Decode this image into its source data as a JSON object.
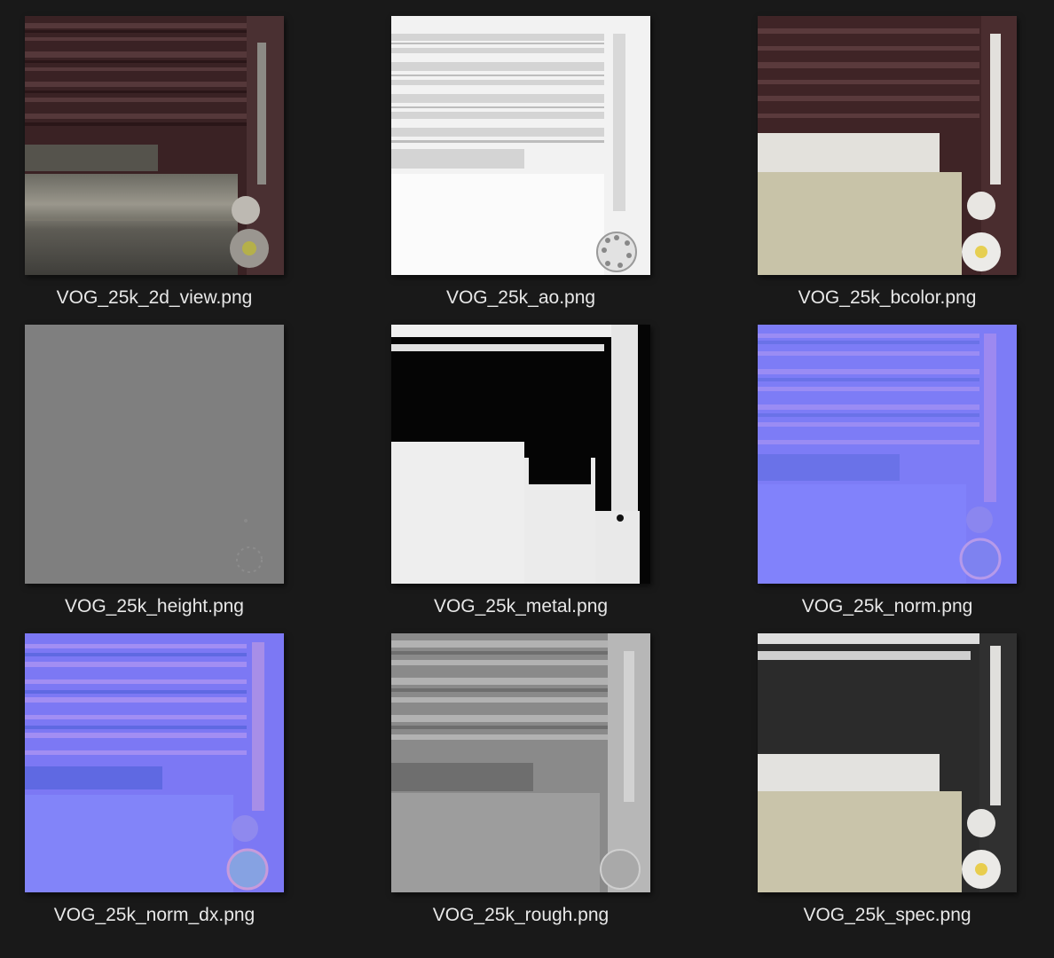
{
  "files": [
    {
      "name": "VOG_25k_2d_view.png",
      "icon": "texture-2d-view-thumbnail"
    },
    {
      "name": "VOG_25k_ao.png",
      "icon": "texture-ao-thumbnail"
    },
    {
      "name": "VOG_25k_bcolor.png",
      "icon": "texture-bcolor-thumbnail"
    },
    {
      "name": "VOG_25k_height.png",
      "icon": "texture-height-thumbnail"
    },
    {
      "name": "VOG_25k_metal.png",
      "icon": "texture-metal-thumbnail"
    },
    {
      "name": "VOG_25k_norm.png",
      "icon": "texture-norm-thumbnail"
    },
    {
      "name": "VOG_25k_norm_dx.png",
      "icon": "texture-norm-dx-thumbnail"
    },
    {
      "name": "VOG_25k_rough.png",
      "icon": "texture-rough-thumbnail"
    },
    {
      "name": "VOG_25k_spec.png",
      "icon": "texture-spec-thumbnail"
    }
  ],
  "colors": {
    "background": "#191919",
    "label": "#e8e8e8"
  }
}
